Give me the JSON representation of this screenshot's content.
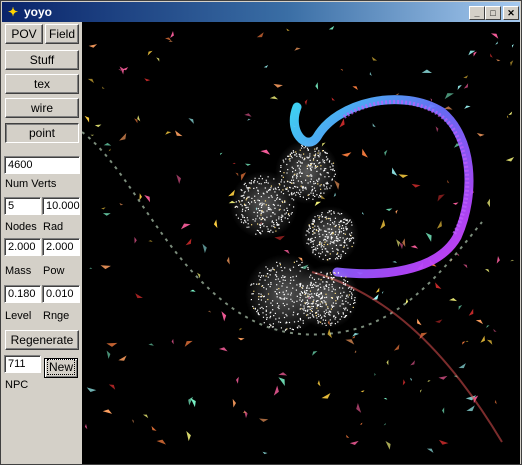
{
  "window": {
    "title": "yoyo",
    "minimize_label": "_",
    "maximize_label": "□",
    "close_label": "✕"
  },
  "panel": {
    "pov_label": "POV",
    "field_label": "Field",
    "stuff_label": "Stuff",
    "tex_label": "tex",
    "wire_label": "wire",
    "point_label": "point",
    "num_verts_value": "4600",
    "num_verts_label": "Num Verts",
    "nodes_value": "5",
    "rad_value": "10.000",
    "nodes_label": "Nodes",
    "rad_label": "Rad",
    "mass_value": "2.000",
    "pow_value": "2.000",
    "mass_label": "Mass",
    "pow_label": "Pow",
    "level_value": "0.180",
    "rnge_value": "0.010",
    "level_label": "Level",
    "rnge_label": "Rnge",
    "regenerate_label": "Regenerate",
    "npc_value": "711",
    "new_label": "New",
    "npc_label": "NPC"
  },
  "colors": {
    "titlebar_start": "#0a246a",
    "titlebar_end": "#a6caf0",
    "viewport_bg": "#000000",
    "ribbon_cyan": "#40e0ff",
    "ribbon_purple": "#9050ff",
    "ribbon_magenta": "#e040ff"
  },
  "icons": {
    "app": "yoyo-app-icon"
  }
}
